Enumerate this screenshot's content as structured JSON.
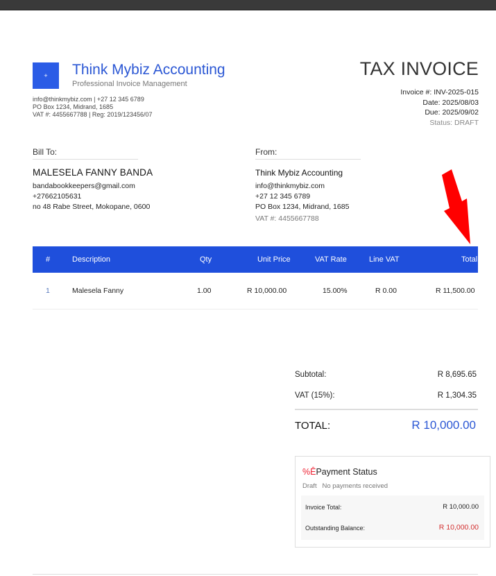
{
  "company": {
    "logo_glyph": "+",
    "name": "Think Mybiz Accounting",
    "tagline": "Professional Invoice Management",
    "contact_line1": "info@thinkmybiz.com | +27 12 345 6789",
    "contact_line2": "PO Box 1234, Midrand, 1685",
    "contact_line3": "VAT #: 4455667788 | Reg: 2019/123456/07"
  },
  "invoice": {
    "title": "TAX INVOICE",
    "number": "Invoice #: INV-2025-015",
    "date": "Date: 2025/08/03",
    "due": "Due: 2025/09/02",
    "status": "Status: DRAFT"
  },
  "bill_to": {
    "label": "Bill To:",
    "name": "MALESELA FANNY BANDA",
    "email": "bandabookkeepers@gmail.com",
    "phone": "+27662105631",
    "address": "no 48 Rabe Street, Mokopane, 0600"
  },
  "from": {
    "label": "From:",
    "name": "Think Mybiz Accounting",
    "email": "info@thinkmybiz.com",
    "phone": "+27 12 345 6789",
    "address": "PO Box 1234, Midrand, 1685",
    "vat": "VAT #: 4455667788"
  },
  "table": {
    "headers": {
      "num": "#",
      "description": "Description",
      "qty": "Qty",
      "unit_price": "Unit Price",
      "vat_rate": "VAT Rate",
      "line_vat": "Line VAT",
      "total": "Total"
    },
    "rows": [
      {
        "num": "1",
        "description": "Malesela Fanny",
        "qty": "1.00",
        "unit_price": "R 10,000.00",
        "vat_rate": "15.00%",
        "line_vat": "R 0.00",
        "total": "R 11,500.00"
      }
    ]
  },
  "totals": {
    "subtotal_label": "Subtotal:",
    "subtotal_value": "R 8,695.65",
    "vat_label": "VAT (15%):",
    "vat_value": "R 1,304.35",
    "total_label": "TOTAL:",
    "total_value": "R 10,000.00"
  },
  "payment": {
    "glyph": "%Ê",
    "title": "Payment Status",
    "state": "Draft",
    "note": "No payments received",
    "invoice_total_label": "Invoice Total:",
    "invoice_total_value": "R 10,000.00",
    "outstanding_label": "Outstanding Balance:",
    "outstanding_value": "R 10,000.00"
  },
  "colors": {
    "brand_blue": "#2b57d4",
    "table_header": "#1f4fdc",
    "accent_red": "#d32f2f",
    "arrow_red": "#ff0000"
  }
}
